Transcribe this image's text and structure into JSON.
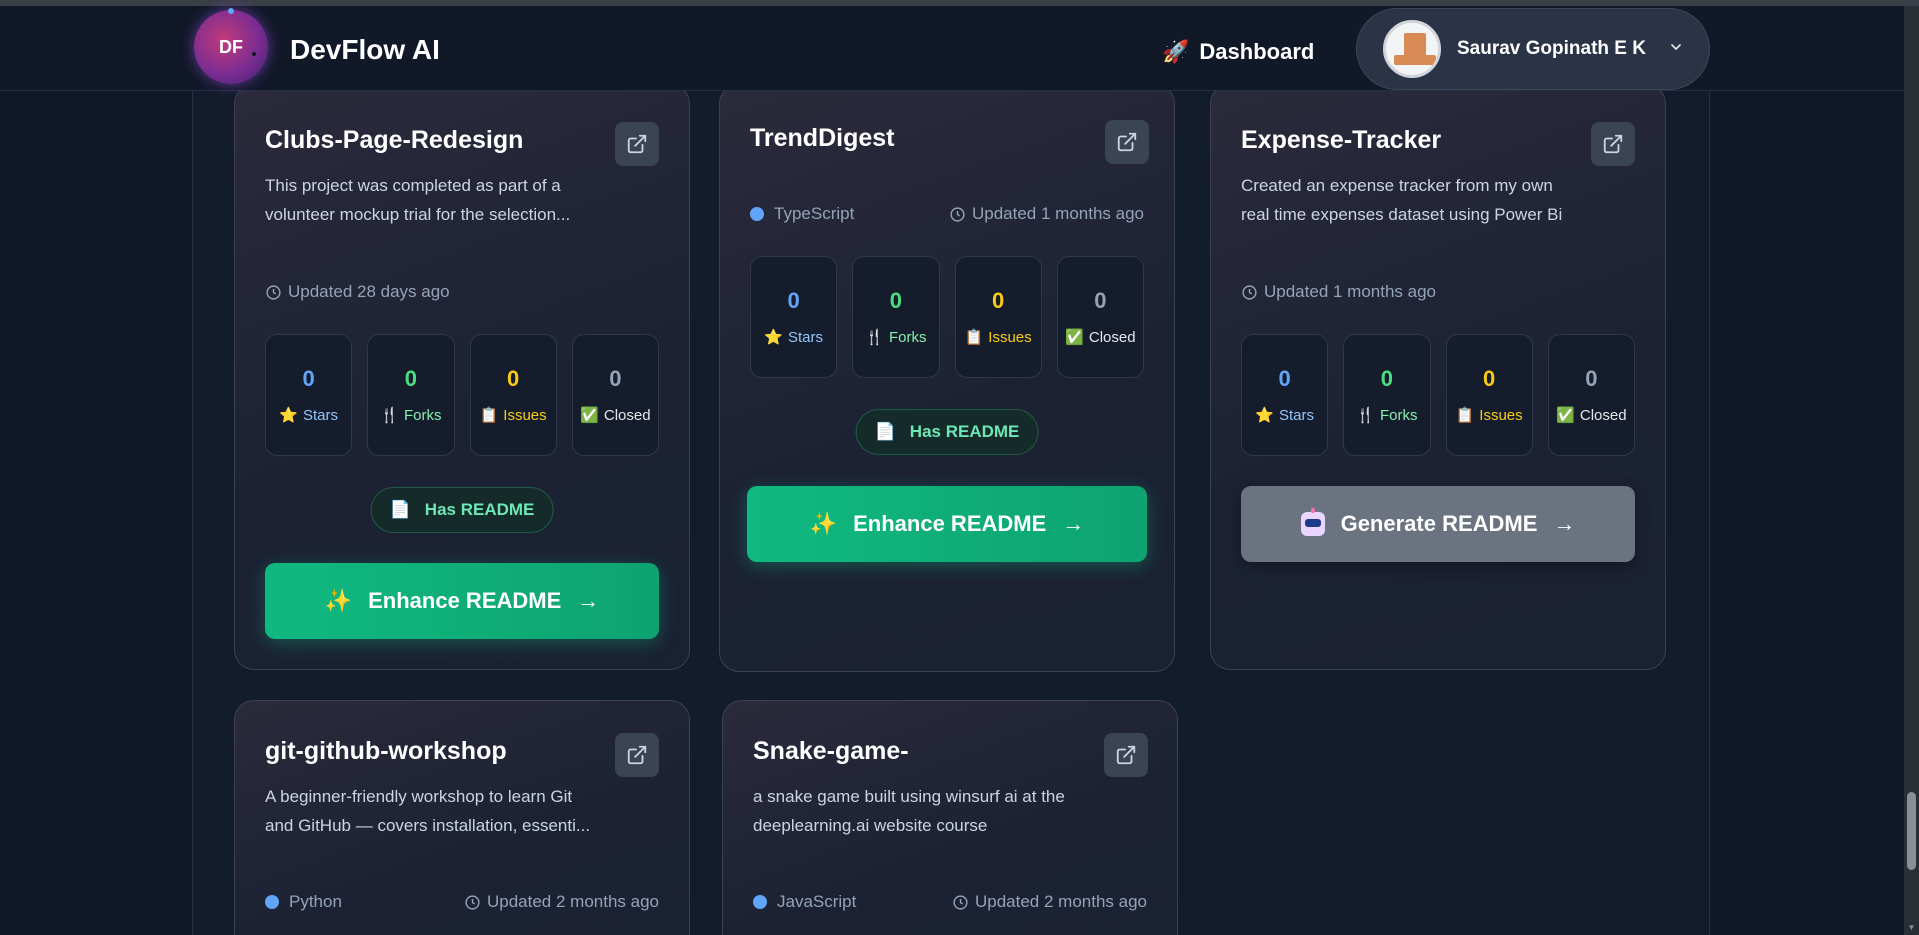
{
  "header": {
    "logo_text": "DF",
    "brand": "DevFlow AI",
    "nav_dashboard": "Dashboard",
    "user_name": "Saurav Gopinath E K"
  },
  "stat_labels": {
    "stars": "Stars",
    "forks": "Forks",
    "issues": "Issues",
    "closed": "Closed"
  },
  "readme_badge": "Has README",
  "cards": [
    {
      "title": "Clubs-Page-Redesign",
      "description": "This project was completed as part of a volunteer mockup trial for the selection...",
      "language": "",
      "updated": "Updated 28 days ago",
      "stars": "0",
      "forks": "0",
      "issues": "0",
      "closed": "0",
      "has_readme": true,
      "action": "Enhance README"
    },
    {
      "title": "TrendDigest",
      "description": "",
      "language": "TypeScript",
      "updated": "Updated 1 months ago",
      "stars": "0",
      "forks": "0",
      "issues": "0",
      "closed": "0",
      "has_readme": true,
      "action": "Enhance README"
    },
    {
      "title": "Expense-Tracker",
      "description": "Created an expense tracker from my own real time expenses dataset using Power Bi",
      "language": "",
      "updated": "Updated 1 months ago",
      "stars": "0",
      "forks": "0",
      "issues": "0",
      "closed": "0",
      "has_readme": false,
      "action": "Generate README"
    },
    {
      "title": "git-github-workshop",
      "description": "A beginner-friendly workshop to learn Git and GitHub — covers installation, essenti...",
      "language": "Python",
      "updated": "Updated 2 months ago"
    },
    {
      "title": "Snake-game-",
      "description": "a snake game built using winsurf ai at the deeplearning.ai website course",
      "language": "JavaScript",
      "updated": "Updated 2 months ago"
    }
  ],
  "colors": {
    "background": "#111827",
    "accent_green": "#10b981",
    "stars": "#60a5fa",
    "forks": "#4ade80",
    "issues": "#facc15",
    "closed": "#94a3b8"
  }
}
